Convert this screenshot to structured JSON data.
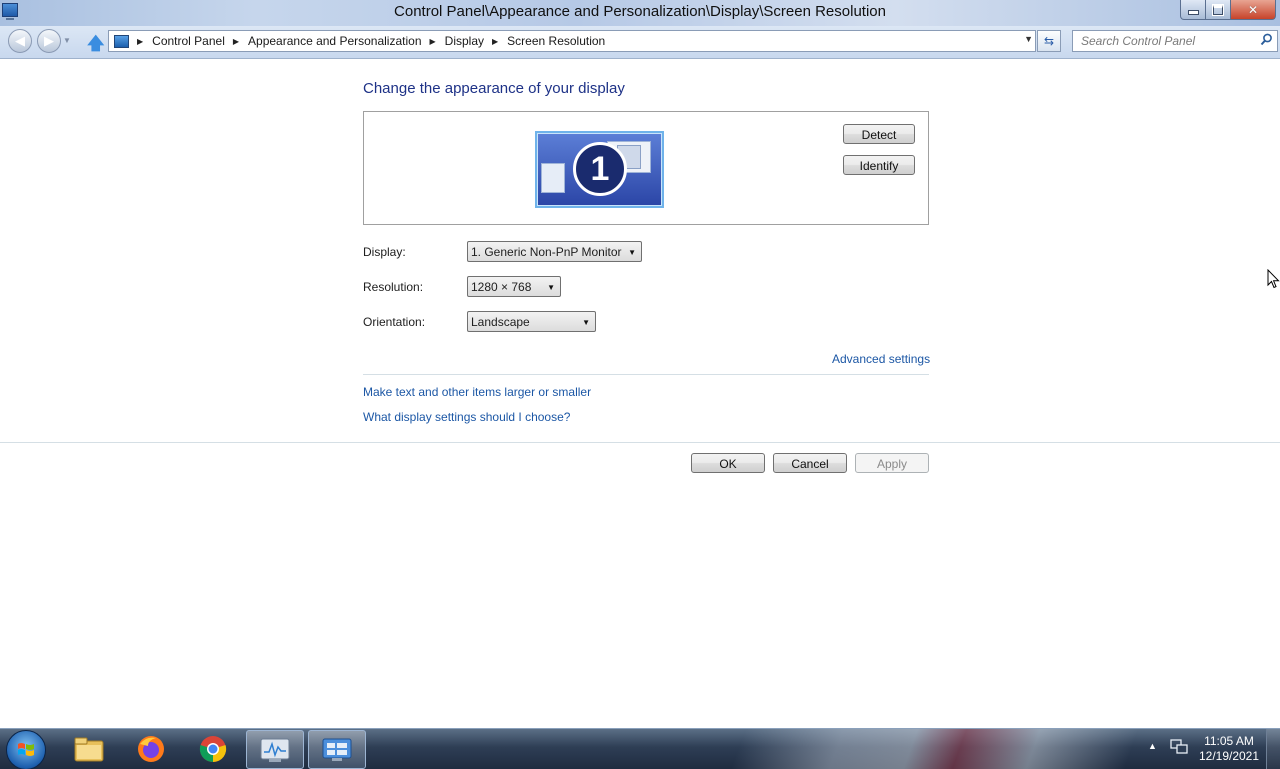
{
  "window": {
    "title": "Control Panel\\Appearance and Personalization\\Display\\Screen Resolution"
  },
  "address_bar": {
    "breadcrumbs": [
      "Control Panel",
      "Appearance and Personalization",
      "Display",
      "Screen Resolution"
    ],
    "search_placeholder": "Search Control Panel"
  },
  "content": {
    "heading": "Change the appearance of your display",
    "monitor_number": "1",
    "detect_label": "Detect",
    "identify_label": "Identify",
    "display_label": "Display:",
    "display_value": "1. Generic Non-PnP Monitor",
    "resolution_label": "Resolution:",
    "resolution_value": "1280 × 768",
    "orientation_label": "Orientation:",
    "orientation_value": "Landscape",
    "advanced_link": "Advanced settings",
    "text_size_link": "Make text and other items larger or smaller",
    "help_link": "What display settings should I choose?"
  },
  "buttons": {
    "ok": "OK",
    "cancel": "Cancel",
    "apply": "Apply"
  },
  "taskbar": {
    "items": [
      "windows-explorer",
      "firefox",
      "chrome",
      "performance-monitor",
      "control-panel-display"
    ],
    "time": "11:05 AM",
    "date": "12/19/2021"
  },
  "colors": {
    "heading": "#1e3287",
    "link": "#1c57a5"
  }
}
